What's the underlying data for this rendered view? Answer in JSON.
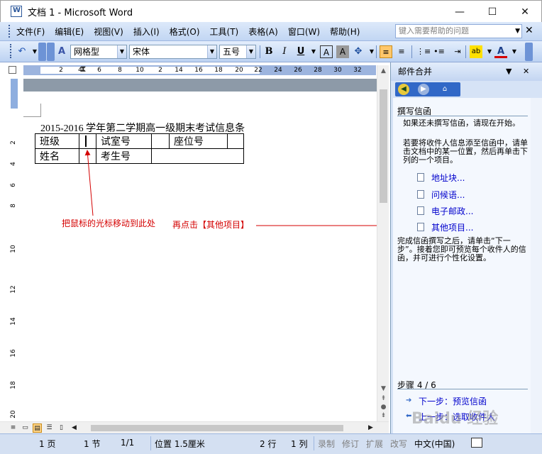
{
  "window": {
    "title": "文档 1 - Microsoft Word",
    "minimize": "—",
    "maximize": "☐",
    "close": "✕"
  },
  "menu": {
    "items": [
      "文件(F)",
      "编辑(E)",
      "视图(V)",
      "插入(I)",
      "格式(O)",
      "工具(T)",
      "表格(A)",
      "窗口(W)",
      "帮助(H)"
    ],
    "help_placeholder": "键入需要帮助的问题"
  },
  "toolbar": {
    "style_value": "网格型",
    "font_value": "宋体",
    "size_value": "五号",
    "bold": "B",
    "italic": "I",
    "underline": "U",
    "char_border": "A",
    "char_shade": "A",
    "font_color": "A"
  },
  "ruler": {
    "numbers": [
      "2",
      "4",
      "6",
      "8",
      "10",
      "2",
      "14",
      "16",
      "18",
      "20",
      "22",
      "24",
      "26",
      "28",
      "30",
      "32"
    ],
    "vnumbers": [
      "2",
      "4",
      "6",
      "8",
      "10",
      "12",
      "14",
      "16",
      "18",
      "20"
    ]
  },
  "document": {
    "title": "2015-2016 学年第二学期高一级期末考试信息条",
    "row1": [
      "班级",
      "",
      "试室号",
      "",
      "座位号",
      ""
    ],
    "row2": [
      "姓名",
      "",
      "考生号",
      ""
    ]
  },
  "annotations": {
    "cursor_hint": "把鼠标的光标移动到此处",
    "click_hint": "再点击【其他项目】"
  },
  "task_pane": {
    "title": "邮件合并",
    "section_title": "撰写信函",
    "intro1": "如果还未撰写信函，请现在开始。",
    "intro2": "若要将收件人信息添至信函中，请单击文档中的某一位置，然后再单击下列的一个项目。",
    "links": [
      "地址块...",
      "问候语...",
      "电子邮政...",
      "其他项目..."
    ],
    "after": "完成信函撰写之后，请单击“下一步”。接着您即可预览每个收件人的信函，并可进行个性化设置。",
    "step": "步骤 4 / 6",
    "next": "下一步：预览信函",
    "prev": "上一步：选取收件人"
  },
  "status": {
    "page": "1 页",
    "section": "1 节",
    "pages": "1/1",
    "position": "位置 1.5厘米",
    "line": "2 行",
    "column": "1 列",
    "rec": "录制",
    "trk": "修订",
    "ext": "扩展",
    "ovr": "改写",
    "lang": "中文(中国)"
  },
  "watermark": "Baidu 经验",
  "colors": {
    "annotation": "#d40000",
    "link": "#0000cc",
    "pane_bg": "#d6e3f6",
    "menubar": "#c1d6f3"
  }
}
